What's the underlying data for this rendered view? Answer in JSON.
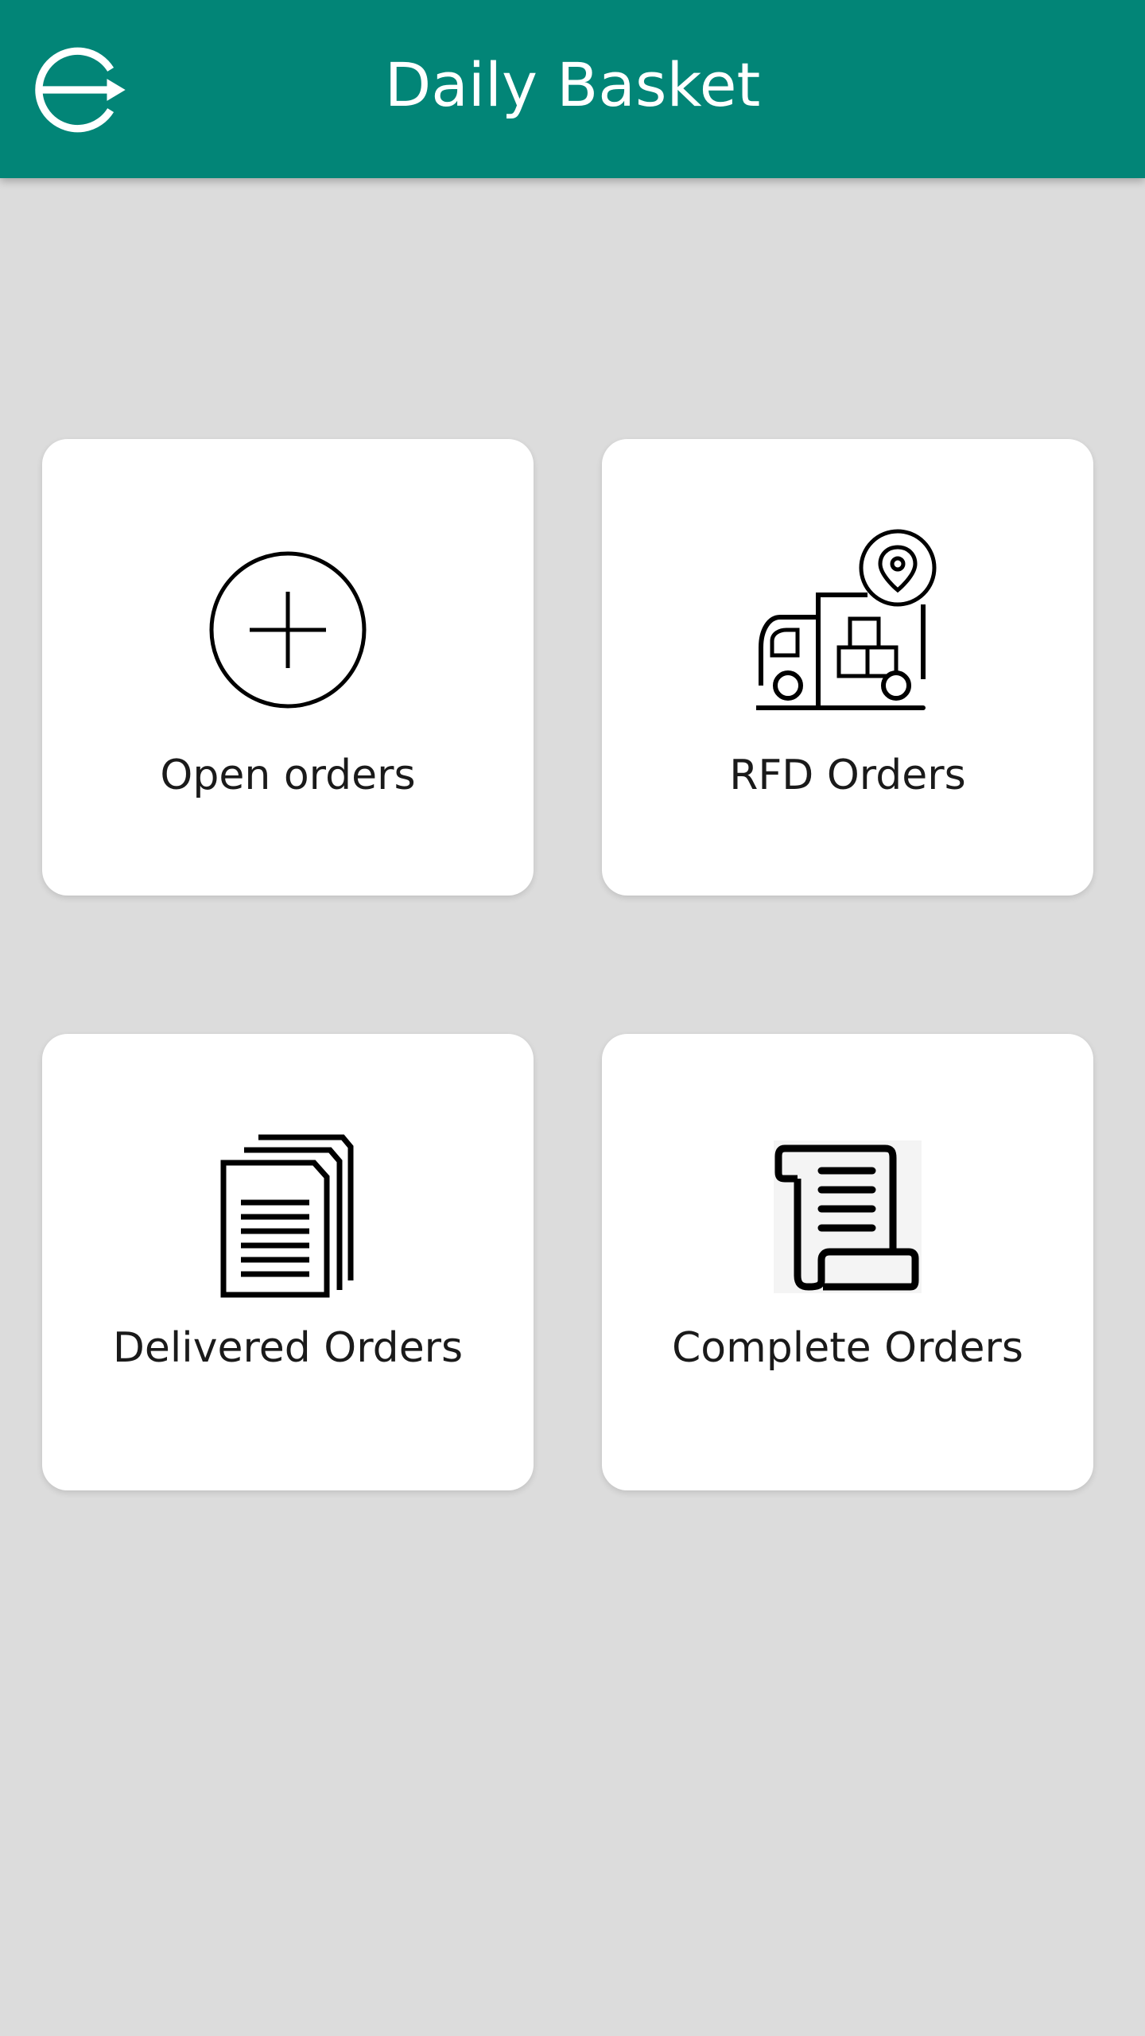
{
  "header": {
    "title": "Daily Basket",
    "logout_icon": "logout-icon",
    "background_color": "#028577"
  },
  "tiles": [
    {
      "label": "Open orders",
      "icon": "add-circle-icon"
    },
    {
      "label": "RFD Orders",
      "icon": "delivery-truck-icon"
    },
    {
      "label": "Delivered Orders",
      "icon": "documents-stack-icon"
    },
    {
      "label": "Complete Orders",
      "icon": "receipt-scroll-icon"
    }
  ]
}
